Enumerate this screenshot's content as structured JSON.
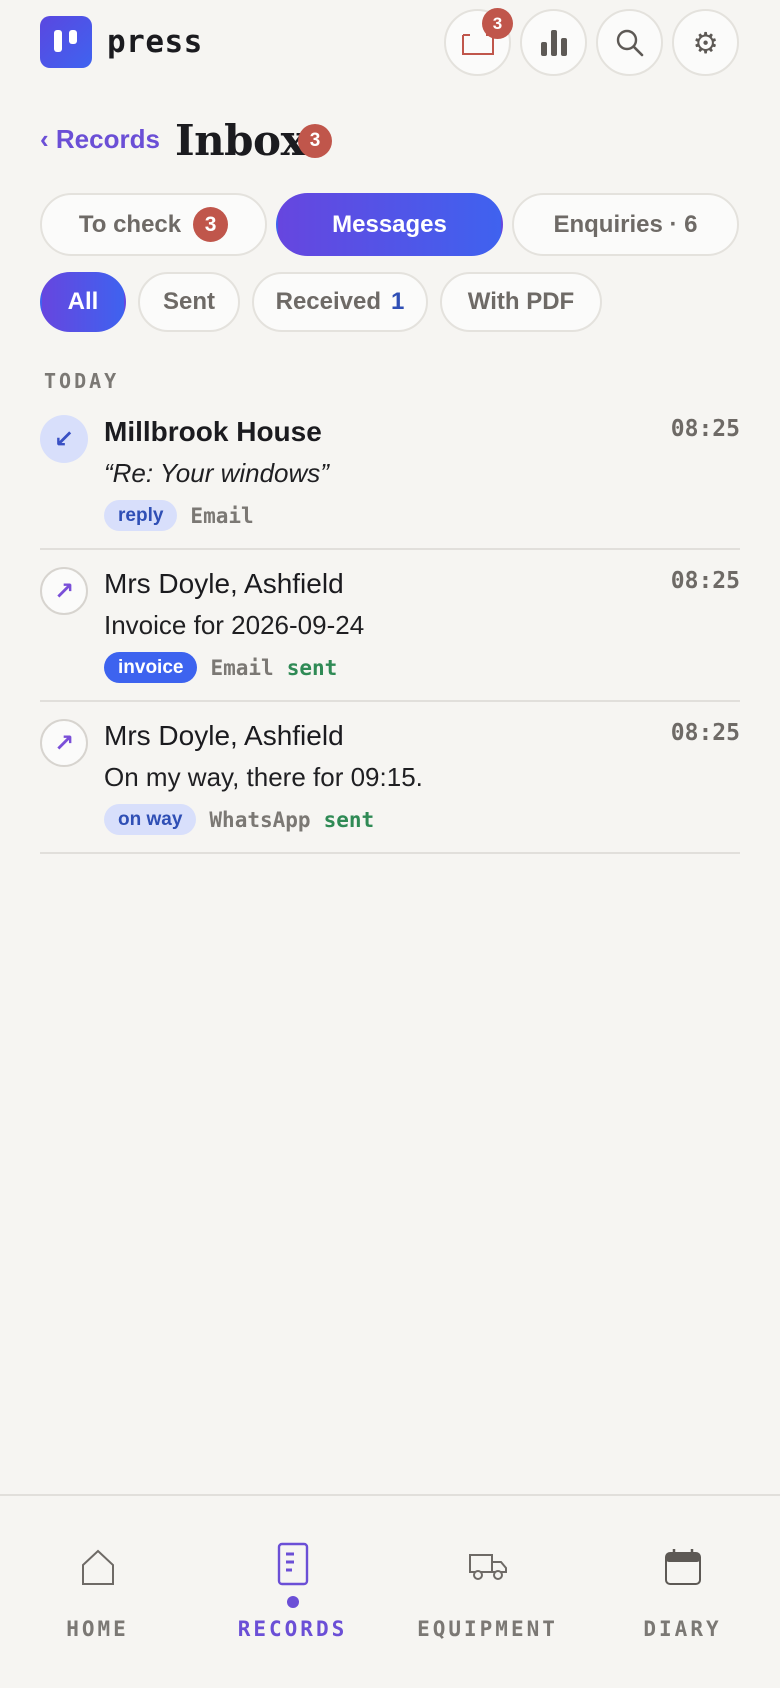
{
  "app": {
    "brand": "press"
  },
  "header": {
    "inbox_badge": "3",
    "buttons": [
      "inbox-tray-icon",
      "bar-chart-icon",
      "search-icon",
      "gear-icon"
    ],
    "settings_glyph": "⚙"
  },
  "nav_title": {
    "back_label": "‹ Records",
    "title": "Inbox",
    "badge": "3"
  },
  "tabs": [
    {
      "label": "To check",
      "badge": "3"
    },
    {
      "label": "Messages",
      "active": true
    },
    {
      "label": "Enquiries · 6"
    }
  ],
  "filters": [
    {
      "label": "All",
      "active": true
    },
    {
      "label": "Sent"
    },
    {
      "label": "Received",
      "count": "1"
    },
    {
      "label": "With PDF"
    }
  ],
  "section_label": "TODAY",
  "messages": [
    {
      "direction": "incoming",
      "direction_glyph": "↙",
      "name": "Millbrook House",
      "time": "08:25",
      "preview": "“Re: Your windows”",
      "tag": "reply",
      "channel": "Email",
      "status": ""
    },
    {
      "direction": "outgoing",
      "direction_glyph": "↗",
      "name": "Mrs Doyle, Ashfield",
      "time": "08:25",
      "preview": "Invoice for 2026-09-24",
      "tag": "invoice",
      "channel": "Email",
      "status": "sent"
    },
    {
      "direction": "outgoing",
      "direction_glyph": "↗",
      "name": "Mrs Doyle, Ashfield",
      "time": "08:25",
      "preview": "On my way, there for 09:15.",
      "tag": "on way",
      "channel": "WhatsApp",
      "status": "sent"
    }
  ],
  "bottom_nav": [
    {
      "label": "HOME",
      "icon": "house-icon"
    },
    {
      "label": "RECORDS",
      "icon": "document-icon",
      "active": true
    },
    {
      "label": "EQUIPMENT",
      "icon": "van-icon"
    },
    {
      "label": "DIARY",
      "icon": "calendar-icon"
    }
  ],
  "colors": {
    "accent": "#6b4fd6",
    "accent_blue": "#3d63ef",
    "badge_red": "#c0564b",
    "sent_green": "#2f8a55",
    "background": "#f6f5f2"
  }
}
